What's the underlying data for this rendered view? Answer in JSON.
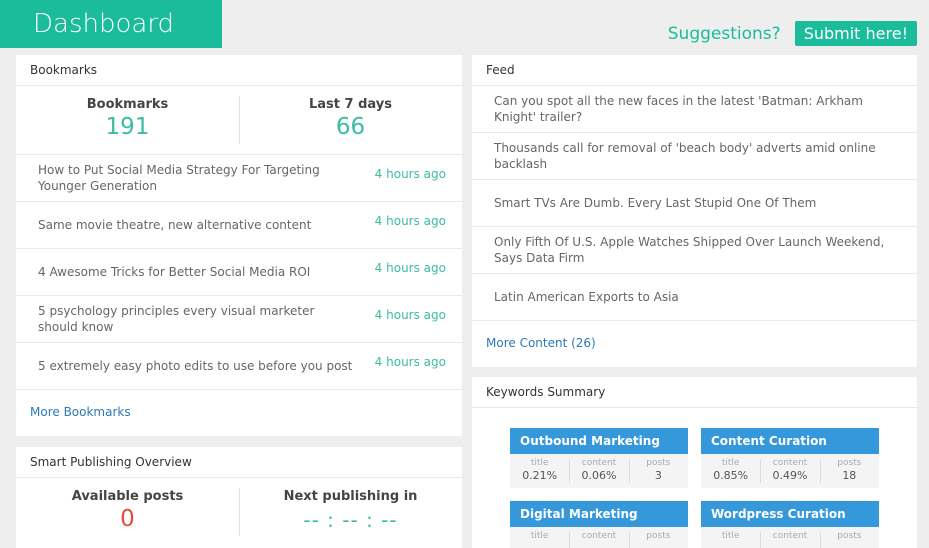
{
  "header": {
    "title": "Dashboard",
    "suggestions_label": "Suggestions?",
    "submit_label": "Submit here!"
  },
  "bookmarks": {
    "panel_title": "Bookmarks",
    "stats": [
      {
        "label": "Bookmarks",
        "value": "191"
      },
      {
        "label": "Last 7 days",
        "value": "66"
      }
    ],
    "items": [
      {
        "title": "How to Put Social Media Strategy For Targeting Younger Generation",
        "time": "4 hours ago"
      },
      {
        "title": "Same movie theatre, new alternative content",
        "time": "4 hours ago"
      },
      {
        "title": "4 Awesome Tricks for Better Social Media ROI",
        "time": "4 hours ago"
      },
      {
        "title": "5 psychology principles every visual marketer should know",
        "time": "4 hours ago"
      },
      {
        "title": "5 extremely easy photo edits to use before you post",
        "time": "4 hours ago"
      }
    ],
    "more_label": "More Bookmarks"
  },
  "publishing": {
    "panel_title": "Smart Publishing Overview",
    "available_label": "Available posts",
    "available_value": "0",
    "next_label": "Next publishing in",
    "next_value": "-- : -- : --"
  },
  "feed": {
    "panel_title": "Feed",
    "items": [
      "Can you spot all the new faces in the latest 'Batman: Arkham Knight' trailer?",
      "Thousands call for removal of 'beach body' adverts amid online backlash",
      "Smart TVs Are Dumb. Every Last Stupid One Of Them",
      "Only Fifth Of U.S. Apple Watches Shipped Over Launch Weekend, Says Data Firm",
      "Latin American Exports to Asia"
    ],
    "more_label": "More Content (26)"
  },
  "keywords": {
    "panel_title": "Keywords Summary",
    "col_labels": [
      "title",
      "content",
      "posts"
    ],
    "cards": [
      {
        "name": "Outbound Marketing",
        "title": "0.21%",
        "content": "0.06%",
        "posts": "3"
      },
      {
        "name": "Content Curation",
        "title": "0.85%",
        "content": "0.49%",
        "posts": "18"
      },
      {
        "name": "Digital Marketing",
        "title": "",
        "content": "",
        "posts": ""
      },
      {
        "name": "Wordpress Curation",
        "title": "",
        "content": "",
        "posts": ""
      }
    ]
  },
  "colors": {
    "brand": "#1abc9c",
    "link": "#2d79b9",
    "danger": "#e74c3c",
    "keyword_header": "#3498db"
  }
}
